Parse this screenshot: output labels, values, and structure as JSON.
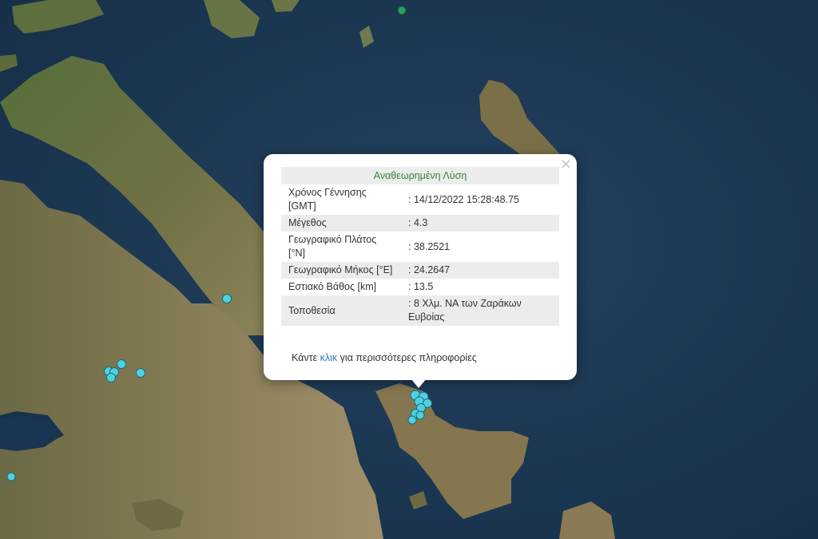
{
  "popup": {
    "title": "Αναθεωρημένη Λύση",
    "close_symbol": "×",
    "rows": [
      {
        "label": "Χρόνος Γέννησης [GMT]",
        "value": ": 14/12/2022 15:28:48.75"
      },
      {
        "label": "Μέγεθος",
        "value": ": 4.3"
      },
      {
        "label": "Γεωγραφικό Πλάτος [°N]",
        "value": ": 38.2521"
      },
      {
        "label": "Γεωγραφικό Μήκος [°E]",
        "value": ": 24.2647"
      },
      {
        "label": "Εστιακό Βάθος [km]",
        "value": ": 13.5"
      },
      {
        "label": "Τοποθεσία",
        "value": ": 8 Χλμ. ΝΑ των Ζαράκων Ευβοίας"
      }
    ],
    "more_prefix": "Κάντε ",
    "more_link": "κλικ",
    "more_suffix": " για περισσότερες πληροφορίες"
  },
  "colors": {
    "sea": "#1d3a57",
    "land_dark": "#3f5a2c",
    "land_light": "#8a8457",
    "marker": "#4fd0e0",
    "marker_green": "#2aa060",
    "title_green": "#2e8b2e",
    "link_blue": "#2a7ab8"
  }
}
